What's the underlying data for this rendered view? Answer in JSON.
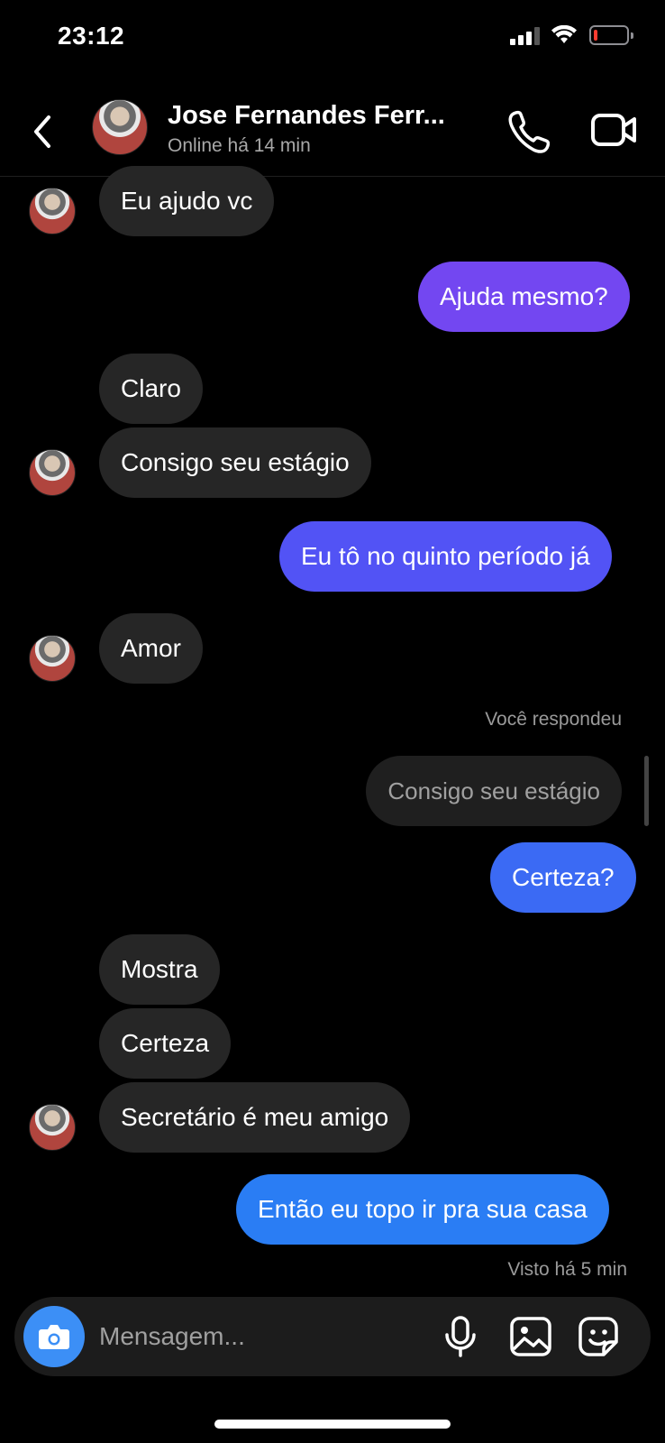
{
  "status_bar": {
    "time": "23:12",
    "signal_bars": 3,
    "signal_max": 4,
    "battery_level": 0.12,
    "battery_color": "#ff3b30"
  },
  "header": {
    "contact_name": "Jose Fernandes Ferr...",
    "contact_status": "Online há 14 min",
    "icons": [
      "back-arrow-icon",
      "phone-icon",
      "video-camera-icon"
    ]
  },
  "messages": [
    {
      "side": "received",
      "text": "Eu ajudo vc"
    },
    {
      "side": "sent",
      "text": "Ajuda mesmo?"
    },
    {
      "side": "received",
      "text": "Claro"
    },
    {
      "side": "received",
      "text": "Consigo seu estágio"
    },
    {
      "side": "sent",
      "text": "Eu tô no quinto período já"
    },
    {
      "side": "received",
      "text": "Amor"
    },
    {
      "side": "sent",
      "text": "Certeza?",
      "reply_label": "Você respondeu",
      "reply_quote": "Consigo seu estágio"
    },
    {
      "side": "received",
      "text": "Mostra"
    },
    {
      "side": "received",
      "text": "Certeza"
    },
    {
      "side": "received",
      "text": "Secretário é meu amigo"
    },
    {
      "side": "sent",
      "text": "Então eu topo ir pra sua casa"
    }
  ],
  "seen_status": "Visto há 5 min",
  "composer": {
    "placeholder": "Mensagem...",
    "icons": [
      "camera-icon",
      "microphone-icon",
      "gallery-icon",
      "sticker-icon"
    ]
  },
  "colors": {
    "sent_gradient_top": "#7347f1",
    "sent_gradient_bottom": "#2a7df4",
    "received_bubble": "#262626",
    "camera_button": "#3c8ff6"
  }
}
